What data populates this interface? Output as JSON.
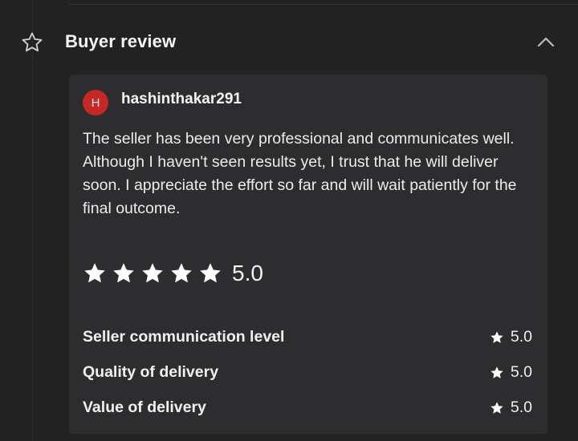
{
  "section": {
    "title": "Buyer review",
    "icon": "star-outline-icon",
    "toggle_icon": "chevron-up-icon"
  },
  "review": {
    "avatar_initial": "H",
    "avatar_color": "#c62828",
    "username": "hashinthakar291",
    "text": "The seller has been very professional and communicates well. Although I haven't seen results yet, I trust that he will deliver soon. I appreciate the effort so far and will wait patiently for the final outcome.",
    "stars": 5,
    "rating": "5.0",
    "criteria": [
      {
        "label": "Seller communication level",
        "score": "5.0"
      },
      {
        "label": "Quality of delivery",
        "score": "5.0"
      },
      {
        "label": "Value of delivery",
        "score": "5.0"
      }
    ]
  }
}
